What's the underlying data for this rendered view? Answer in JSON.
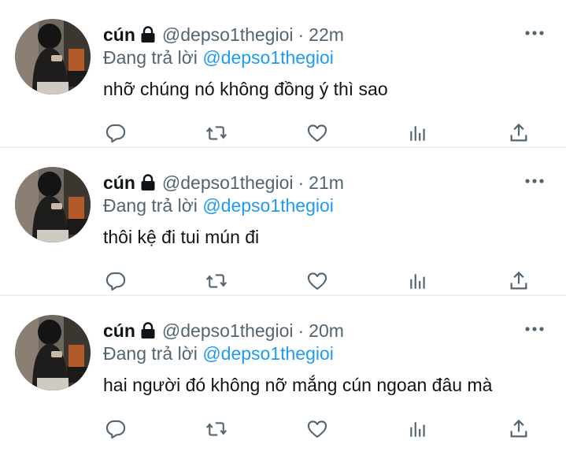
{
  "tweets": [
    {
      "name": "cún",
      "handle": "@depso1thegioi",
      "separator": "·",
      "time": "22m",
      "reply_prefix": "Đang trả lời",
      "reply_to": "@depso1thegioi",
      "text": "nhỡ chúng nó không đồng ý thì sao"
    },
    {
      "name": "cún",
      "handle": "@depso1thegioi",
      "separator": "·",
      "time": "21m",
      "reply_prefix": "Đang trả lời",
      "reply_to": "@depso1thegioi",
      "text": "thôi kệ đi tui mún đi"
    },
    {
      "name": "cún",
      "handle": "@depso1thegioi",
      "separator": "·",
      "time": "20m",
      "reply_prefix": "Đang trả lời",
      "reply_to": "@depso1thegioi",
      "text": "hai người đó không nỡ mắng cún ngoan đâu mà"
    }
  ],
  "icons": {
    "lock": "lock-icon",
    "more": "more-icon",
    "reply": "reply-icon",
    "retweet": "retweet-icon",
    "like": "heart-icon",
    "views": "analytics-icon",
    "share": "share-icon"
  },
  "colors": {
    "text": "#0f1419",
    "secondary": "#536471",
    "link": "#1d9bf0",
    "divider": "#eff3f4"
  }
}
